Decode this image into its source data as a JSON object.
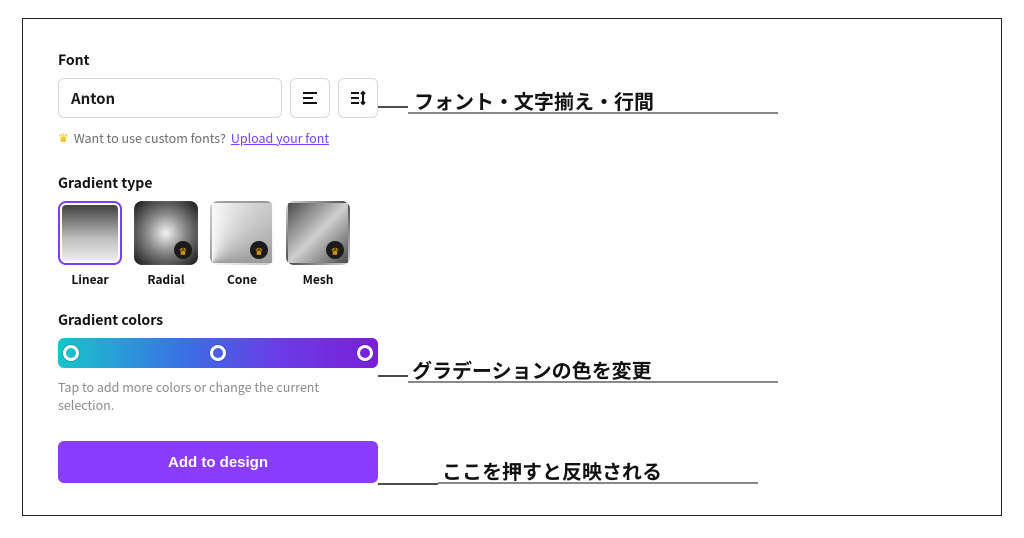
{
  "font": {
    "label": "Font",
    "selected": "Anton",
    "customPrompt": "Want to use custom fonts?",
    "uploadLink": "Upload your font"
  },
  "gradientType": {
    "label": "Gradient type",
    "items": [
      {
        "name": "Linear",
        "selected": true,
        "premium": false
      },
      {
        "name": "Radial",
        "selected": false,
        "premium": true
      },
      {
        "name": "Cone",
        "selected": false,
        "premium": true
      },
      {
        "name": "Mesh",
        "selected": false,
        "premium": true
      }
    ]
  },
  "gradientColors": {
    "label": "Gradient colors",
    "stops": [
      0,
      50,
      100
    ],
    "hint": "Tap to add more colors or change the current selection."
  },
  "addBtn": "Add to design",
  "annotations": {
    "font": "フォント・文字揃え・行間",
    "colors": "グラデーションの色を変更",
    "apply": "ここを押すと反映される"
  }
}
